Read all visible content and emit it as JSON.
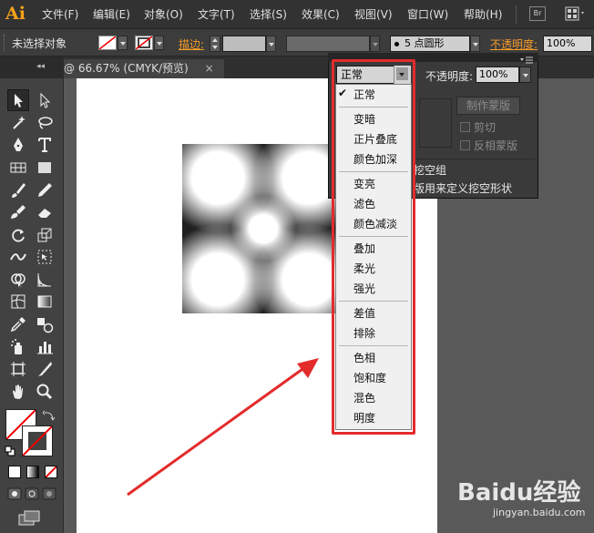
{
  "app": {
    "logo": "Ai"
  },
  "menus": [
    "文件(F)",
    "编辑(E)",
    "对象(O)",
    "文字(T)",
    "选择(S)",
    "效果(C)",
    "视图(V)",
    "窗口(W)",
    "帮助(H)"
  ],
  "menubar_right": {
    "bridge_label": "Br"
  },
  "control_bar": {
    "selection_status": "未选择对象",
    "stroke_label": "描边:",
    "brush_value": "5 点圆形",
    "opacity_label": "不透明度:",
    "opacity_value": "100%"
  },
  "document_tab": {
    "title": "@ 66.67% (CMYK/预览)",
    "close": "×",
    "collapse": "◂◂"
  },
  "transparency_panel": {
    "blend_mode_selected": "正常",
    "opacity_label": "不透明度:",
    "opacity_value": "100%",
    "make_mask_button": "制作蒙版",
    "clip_label": "剪切",
    "invert_mask_label": "反相蒙版",
    "knockout_group_partial": "挖空组",
    "opacity_knockout_partial": "版用来定义挖空形状"
  },
  "blend_menu": {
    "groups": [
      [
        "正常"
      ],
      [
        "变暗",
        "正片叠底",
        "颜色加深"
      ],
      [
        "变亮",
        "滤色",
        "颜色减淡"
      ],
      [
        "叠加",
        "柔光",
        "强光"
      ],
      [
        "差值",
        "排除"
      ],
      [
        "色相",
        "饱和度",
        "混色",
        "明度"
      ]
    ],
    "checked_item": "正常"
  },
  "watermark": {
    "logo": "Baidu经验",
    "url": "jingyan.baidu.com"
  },
  "colors": {
    "annotation_red": "#e32b2b",
    "ai_orange": "#f7a21b",
    "link_orange": "#f59c2b"
  }
}
